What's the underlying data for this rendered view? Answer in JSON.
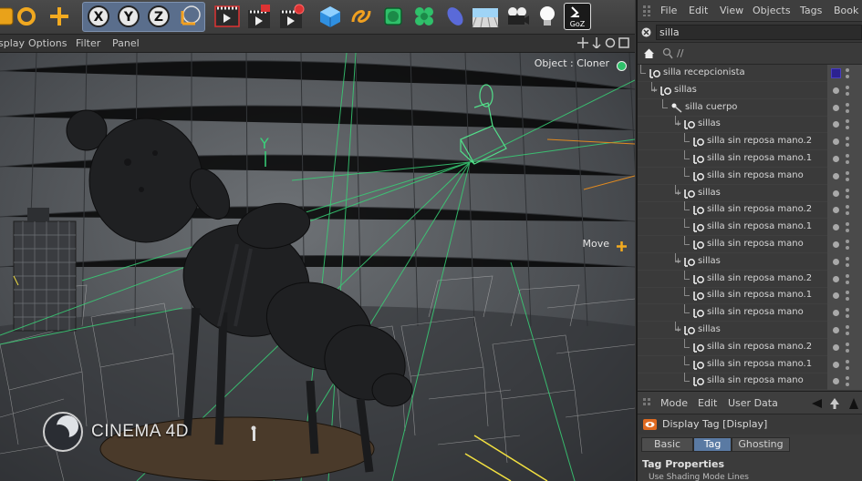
{
  "app": {
    "logo_text": "CINEMA 4D"
  },
  "toolbar": {
    "buttons": [
      {
        "name": "live-selection-icon"
      },
      {
        "name": "rotate-icon"
      },
      {
        "name": "move-icon"
      },
      {
        "name": "axis-x-icon",
        "label": "X"
      },
      {
        "name": "axis-y-icon",
        "label": "Y"
      },
      {
        "name": "axis-z-icon",
        "label": "Z"
      },
      {
        "name": "coordinate-system-icon"
      },
      {
        "name": "render-view-icon"
      },
      {
        "name": "render-picture-viewer-icon"
      },
      {
        "name": "render-settings-icon"
      },
      {
        "name": "cube-icon"
      },
      {
        "name": "spline-icon"
      },
      {
        "name": "subdivision-icon"
      },
      {
        "name": "mograph-cloner-icon"
      },
      {
        "name": "deformer-icon"
      },
      {
        "name": "floor-icon"
      },
      {
        "name": "camera-icon"
      },
      {
        "name": "light-icon"
      },
      {
        "name": "goz-icon",
        "label": "GoZ"
      }
    ]
  },
  "viewport_menu": {
    "items": [
      "splay",
      "Options",
      "Filter",
      "Panel"
    ]
  },
  "viewport": {
    "object_label": "Object : Cloner",
    "move_label": "Move"
  },
  "object_manager": {
    "menu": [
      "File",
      "Edit",
      "View",
      "Objects",
      "Tags",
      "Book"
    ],
    "search_value": "silla",
    "crumb_text": "//",
    "rows": [
      {
        "label": "silla recepcionista",
        "indent": 0,
        "type": "null",
        "tag": true
      },
      {
        "label": "sillas",
        "indent": 1,
        "type": "null",
        "expander": "+"
      },
      {
        "label": "silla cuerpo",
        "indent": 2,
        "type": "joint"
      },
      {
        "label": "sillas",
        "indent": 3,
        "type": "null",
        "expander": "+"
      },
      {
        "label": "silla sin reposa mano.2",
        "indent": 4,
        "type": "null"
      },
      {
        "label": "silla sin reposa mano.1",
        "indent": 4,
        "type": "null"
      },
      {
        "label": "silla sin reposa mano",
        "indent": 4,
        "type": "null"
      },
      {
        "label": "sillas",
        "indent": 3,
        "type": "null",
        "expander": "+"
      },
      {
        "label": "silla sin reposa mano.2",
        "indent": 4,
        "type": "null"
      },
      {
        "label": "silla sin reposa mano.1",
        "indent": 4,
        "type": "null"
      },
      {
        "label": "silla sin reposa mano",
        "indent": 4,
        "type": "null"
      },
      {
        "label": "sillas",
        "indent": 3,
        "type": "null",
        "expander": "+"
      },
      {
        "label": "silla sin reposa mano.2",
        "indent": 4,
        "type": "null"
      },
      {
        "label": "silla sin reposa mano.1",
        "indent": 4,
        "type": "null"
      },
      {
        "label": "silla sin reposa mano",
        "indent": 4,
        "type": "null"
      },
      {
        "label": "sillas",
        "indent": 3,
        "type": "null",
        "expander": "+"
      },
      {
        "label": "silla sin reposa mano.2",
        "indent": 4,
        "type": "null"
      },
      {
        "label": "silla sin reposa mano.1",
        "indent": 4,
        "type": "null"
      },
      {
        "label": "silla sin reposa mano",
        "indent": 4,
        "type": "null"
      }
    ]
  },
  "attribute_manager": {
    "menu": [
      "Mode",
      "Edit",
      "User Data"
    ],
    "title": "Display Tag [Display]",
    "tabs": [
      {
        "label": "Basic",
        "active": false
      },
      {
        "label": "Tag",
        "active": true
      },
      {
        "label": "Ghosting",
        "active": false
      }
    ],
    "section": "Tag Properties",
    "partial_text": "Use   Shading Mode   Lines"
  },
  "colors": {
    "accent_blue": "#5a7aa3",
    "wire_green": "#39d27a",
    "tag_purple": "#2c2290"
  }
}
